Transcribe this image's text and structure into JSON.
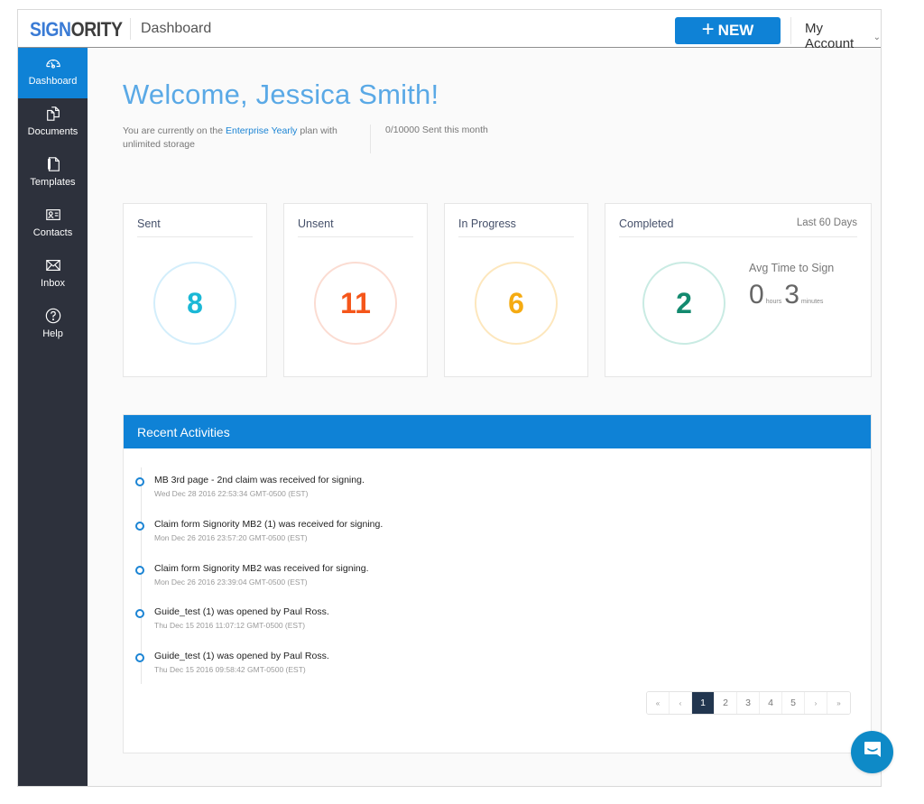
{
  "header": {
    "logo_part1": "SIGN",
    "logo_part2": "ORITY",
    "page_title": "Dashboard",
    "new_button": "NEW",
    "new_button_icon": "plus-icon",
    "account_label": "My Account",
    "account_icon": "chevron-down-icon"
  },
  "sidebar": {
    "items": [
      {
        "label": "Dashboard",
        "icon": "gauge-icon",
        "active": true
      },
      {
        "label": "Documents",
        "icon": "documents-icon",
        "active": false
      },
      {
        "label": "Templates",
        "icon": "templates-icon",
        "active": false
      },
      {
        "label": "Contacts",
        "icon": "contact-card-icon",
        "active": false
      },
      {
        "label": "Inbox",
        "icon": "envelope-icon",
        "active": false
      },
      {
        "label": "Help",
        "icon": "question-circle-icon",
        "active": false
      }
    ]
  },
  "welcome": {
    "greeting": "Welcome, Jessica Smith!",
    "plan_prefix": "You are currently on the ",
    "plan_name": "Enterprise Yearly",
    "plan_suffix": " plan with unlimited storage",
    "sent_this_month": "0/10000 Sent this month"
  },
  "stats": {
    "sent": {
      "title": "Sent",
      "value": "8",
      "color": "#1bb8d6",
      "ring_color": "#d3eefb"
    },
    "unsent": {
      "title": "Unsent",
      "value": "11",
      "color": "#f5561a",
      "ring_color": "#fbdcd2"
    },
    "in_progress": {
      "title": "In Progress",
      "value": "6",
      "color": "#f5ab12",
      "ring_color": "#fde7bd"
    },
    "completed": {
      "title": "Completed",
      "period": "Last 60 Days",
      "value": "2",
      "color": "#138a6f",
      "ring_color": "#c9ebe3",
      "avg_title": "Avg Time to Sign",
      "avg_hours": "0",
      "hours_label": "hours",
      "avg_minutes": "3",
      "minutes_label": "minutes"
    }
  },
  "recent": {
    "title": "Recent Activities",
    "items": [
      {
        "text": "MB 3rd page - 2nd claim was received for signing.",
        "time": "Wed Dec 28 2016 22:53:34 GMT-0500 (EST)"
      },
      {
        "text": "Claim form Signority MB2 (1) was received for signing.",
        "time": "Mon Dec 26 2016 23:57:20 GMT-0500 (EST)"
      },
      {
        "text": "Claim form Signority MB2 was received for signing.",
        "time": "Mon Dec 26 2016 23:39:04 GMT-0500 (EST)"
      },
      {
        "text": "Guide_test (1) was opened by Paul Ross.",
        "time": "Thu Dec 15 2016 11:07:12 GMT-0500 (EST)"
      },
      {
        "text": "Guide_test (1) was opened by Paul Ross.",
        "time": "Thu Dec 15 2016 09:58:42 GMT-0500 (EST)"
      }
    ],
    "pagination": {
      "first": "«",
      "prev": "‹",
      "pages": [
        "1",
        "2",
        "3",
        "4",
        "5"
      ],
      "current": "1",
      "next": "›",
      "last": "»"
    }
  },
  "chat": {
    "icon": "chat-bubble-icon"
  },
  "colors": {
    "brand_blue": "#0f82d6",
    "sidebar_bg": "#2d313c",
    "active_page_bg": "#22364f"
  }
}
